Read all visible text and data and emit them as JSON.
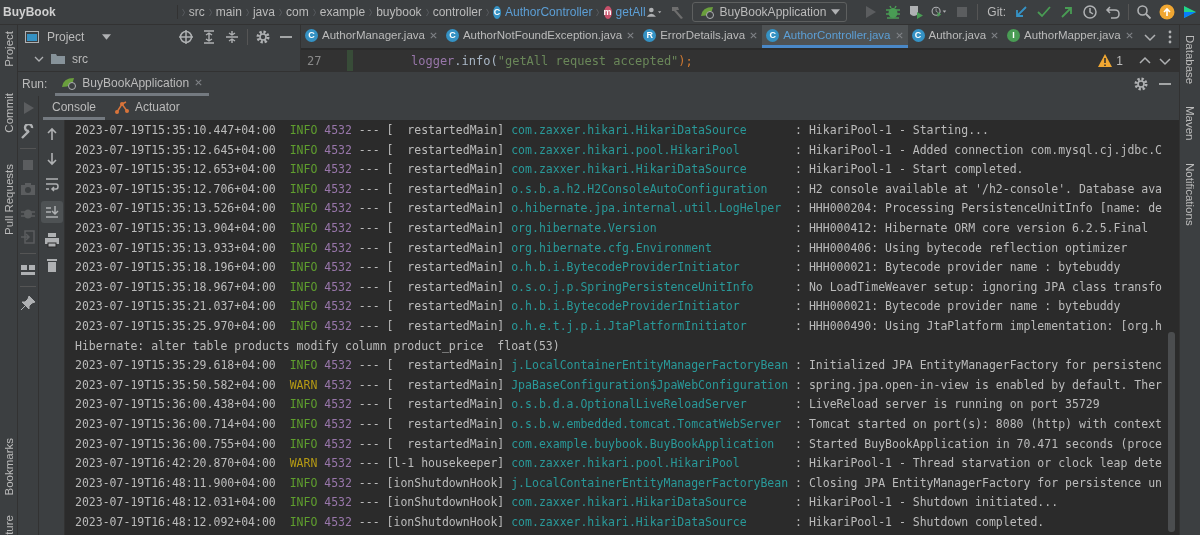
{
  "breadcrumbs": [
    {
      "label": "BuyBook",
      "kind": "project"
    },
    {
      "label": "src",
      "kind": "folder"
    },
    {
      "label": "main",
      "kind": "folder"
    },
    {
      "label": "java",
      "kind": "folder"
    },
    {
      "label": "com",
      "kind": "folder"
    },
    {
      "label": "example",
      "kind": "folder"
    },
    {
      "label": "buybook",
      "kind": "folder"
    },
    {
      "label": "controller",
      "kind": "folder"
    },
    {
      "label": "AuthorController",
      "kind": "class",
      "icon_letter": "C"
    },
    {
      "label": "getAll",
      "kind": "method",
      "icon_letter": "m"
    }
  ],
  "run_config": {
    "label": "BuyBookApplication"
  },
  "git_label": "Git:",
  "project_pane": {
    "title": "Project",
    "tree": [
      {
        "label": "src",
        "expanded": true
      }
    ]
  },
  "editor_tabs": [
    {
      "label": "AuthorManager.java",
      "icon_letter": "C",
      "kind": "class",
      "selected": false
    },
    {
      "label": "AuthorNotFoundException.java",
      "icon_letter": "C",
      "kind": "class",
      "selected": false
    },
    {
      "label": "ErrorDetails.java",
      "icon_letter": "R",
      "kind": "record",
      "selected": false
    },
    {
      "label": "AuthorController.java",
      "icon_letter": "C",
      "kind": "class",
      "selected": true
    },
    {
      "label": "Author.java",
      "icon_letter": "C",
      "kind": "class",
      "selected": false
    },
    {
      "label": "AuthorMapper.java",
      "icon_letter": "I",
      "kind": "interface",
      "selected": false
    }
  ],
  "code_lines": [
    {
      "number": "27",
      "segments": [
        {
          "text": "logger",
          "kind": "field"
        },
        {
          "text": ".info(",
          "kind": "plain"
        },
        {
          "text": "\"getAll request accepted\"",
          "kind": "string"
        },
        {
          "text": ");",
          "kind": "punct"
        }
      ]
    }
  ],
  "inspection": {
    "warnings": "1"
  },
  "run": {
    "label": "Run:",
    "tabs": [
      {
        "label": "BuyBookApplication",
        "selected": true
      }
    ]
  },
  "console_tabs": [
    {
      "label": "Console",
      "selected": true
    },
    {
      "label": "Actuator",
      "selected": false
    }
  ],
  "console": {
    "scroll_to_end": true
  },
  "left_stripe": [
    "Project",
    "Commit",
    "Pull Requests",
    "Bookmarks",
    "ture"
  ],
  "right_stripe": [
    "Database",
    "Maven",
    "Notifications"
  ],
  "log_lines": [
    {
      "kind": "log",
      "time": "2023-07-19T15:35:10.447+04:00",
      "level": "INFO",
      "color": "#5f9e2e",
      "pid": "4532",
      "thread": "--- [  restartedMain]",
      "logger": "com.zaxxer.hikari.HikariDataSource",
      "message": ": HikariPool-1 - Starting..."
    },
    {
      "kind": "log",
      "time": "2023-07-19T15:35:12.645+04:00",
      "level": "INFO",
      "color": "#5f9e2e",
      "pid": "4532",
      "thread": "--- [  restartedMain]",
      "logger": "com.zaxxer.hikari.pool.HikariPool",
      "message": ": HikariPool-1 - Added connection com.mysql.cj.jdbc.C"
    },
    {
      "kind": "log",
      "time": "2023-07-19T15:35:12.653+04:00",
      "level": "INFO",
      "color": "#5f9e2e",
      "pid": "4532",
      "thread": "--- [  restartedMain]",
      "logger": "com.zaxxer.hikari.HikariDataSource",
      "message": ": HikariPool-1 - Start completed."
    },
    {
      "kind": "log",
      "time": "2023-07-19T15:35:12.706+04:00",
      "level": "INFO",
      "color": "#5f9e2e",
      "pid": "4532",
      "thread": "--- [  restartedMain]",
      "logger": "o.s.b.a.h2.H2ConsoleAutoConfiguration",
      "message": ": H2 console available at '/h2-console'. Database ava"
    },
    {
      "kind": "log",
      "time": "2023-07-19T15:35:13.526+04:00",
      "level": "INFO",
      "color": "#5f9e2e",
      "pid": "4532",
      "thread": "--- [  restartedMain]",
      "logger": "o.hibernate.jpa.internal.util.LogHelper",
      "message": ": HHH000204: Processing PersistenceUnitInfo [name: de"
    },
    {
      "kind": "log",
      "time": "2023-07-19T15:35:13.904+04:00",
      "level": "INFO",
      "color": "#5f9e2e",
      "pid": "4532",
      "thread": "--- [  restartedMain]",
      "logger": "org.hibernate.Version",
      "message": ": HHH000412: Hibernate ORM core version 6.2.5.Final"
    },
    {
      "kind": "log",
      "time": "2023-07-19T15:35:13.933+04:00",
      "level": "INFO",
      "color": "#5f9e2e",
      "pid": "4532",
      "thread": "--- [  restartedMain]",
      "logger": "org.hibernate.cfg.Environment",
      "message": ": HHH000406: Using bytecode reflection optimizer"
    },
    {
      "kind": "log",
      "time": "2023-07-19T15:35:18.196+04:00",
      "level": "INFO",
      "color": "#5f9e2e",
      "pid": "4532",
      "thread": "--- [  restartedMain]",
      "logger": "o.h.b.i.BytecodeProviderInitiator",
      "message": ": HHH000021: Bytecode provider name : bytebuddy"
    },
    {
      "kind": "log",
      "time": "2023-07-19T15:35:18.967+04:00",
      "level": "INFO",
      "color": "#5f9e2e",
      "pid": "4532",
      "thread": "--- [  restartedMain]",
      "logger": "o.s.o.j.p.SpringPersistenceUnitInfo",
      "message": ": No LoadTimeWeaver setup: ignoring JPA class transfo"
    },
    {
      "kind": "log",
      "time": "2023-07-19T15:35:21.037+04:00",
      "level": "INFO",
      "color": "#5f9e2e",
      "pid": "4532",
      "thread": "--- [  restartedMain]",
      "logger": "o.h.b.i.BytecodeProviderInitiator",
      "message": ": HHH000021: Bytecode provider name : bytebuddy"
    },
    {
      "kind": "log",
      "time": "2023-07-19T15:35:25.970+04:00",
      "level": "INFO",
      "color": "#5f9e2e",
      "pid": "4532",
      "thread": "--- [  restartedMain]",
      "logger": "o.h.e.t.j.p.i.JtaPlatformInitiator",
      "message": ": HHH000490: Using JtaPlatform implementation: [org.h"
    },
    {
      "kind": "plain",
      "text": "Hibernate: alter table products modify column product_price  float(53)"
    },
    {
      "kind": "log",
      "time": "2023-07-19T15:35:29.618+04:00",
      "level": "INFO",
      "color": "#5f9e2e",
      "pid": "4532",
      "thread": "--- [  restartedMain]",
      "logger": "j.LocalContainerEntityManagerFactoryBean",
      "message": ": Initialized JPA EntityManagerFactory for persistenc"
    },
    {
      "kind": "log",
      "time": "2023-07-19T15:35:50.582+04:00",
      "level": "WARN",
      "color": "#b59a14",
      "pid": "4532",
      "thread": "--- [  restartedMain]",
      "logger": "JpaBaseConfiguration$JpaWebConfiguration",
      "message": ": spring.jpa.open-in-view is enabled by default. Ther"
    },
    {
      "kind": "log",
      "time": "2023-07-19T15:36:00.438+04:00",
      "level": "INFO",
      "color": "#5f9e2e",
      "pid": "4532",
      "thread": "--- [  restartedMain]",
      "logger": "o.s.b.d.a.OptionalLiveReloadServer",
      "message": ": LiveReload server is running on port 35729"
    },
    {
      "kind": "log",
      "time": "2023-07-19T15:36:00.714+04:00",
      "level": "INFO",
      "color": "#5f9e2e",
      "pid": "4532",
      "thread": "--- [  restartedMain]",
      "logger": "o.s.b.w.embedded.tomcat.TomcatWebServer",
      "message": ": Tomcat started on port(s): 8080 (http) with context"
    },
    {
      "kind": "log",
      "time": "2023-07-19T15:36:00.755+04:00",
      "level": "INFO",
      "color": "#5f9e2e",
      "pid": "4532",
      "thread": "--- [  restartedMain]",
      "logger": "com.example.buybook.BuyBookApplication",
      "message": ": Started BuyBookApplication in 70.471 seconds (proce"
    },
    {
      "kind": "log",
      "time": "2023-07-19T16:42:20.870+04:00",
      "level": "WARN",
      "color": "#b59a14",
      "pid": "4532",
      "thread": "--- [l-1 housekeeper]",
      "logger": "com.zaxxer.hikari.pool.HikariPool",
      "message": ": HikariPool-1 - Thread starvation or clock leap dete"
    },
    {
      "kind": "log",
      "time": "2023-07-19T16:48:11.900+04:00",
      "level": "INFO",
      "color": "#5f9e2e",
      "pid": "4532",
      "thread": "--- [ionShutdownHook]",
      "logger": "j.LocalContainerEntityManagerFactoryBean",
      "message": ": Closing JPA EntityManagerFactory for persistence un"
    },
    {
      "kind": "log",
      "time": "2023-07-19T16:48:12.031+04:00",
      "level": "INFO",
      "color": "#5f9e2e",
      "pid": "4532",
      "thread": "--- [ionShutdownHook]",
      "logger": "com.zaxxer.hikari.HikariDataSource",
      "message": ": HikariPool-1 - Shutdown initiated..."
    },
    {
      "kind": "log",
      "time": "2023-07-19T16:48:12.092+04:00",
      "level": "INFO",
      "color": "#5f9e2e",
      "pid": "4532",
      "thread": "--- [ionShutdownHook]",
      "logger": "com.zaxxer.hikari.HikariDataSource",
      "message": ": HikariPool-1 - Shutdown completed."
    }
  ]
}
